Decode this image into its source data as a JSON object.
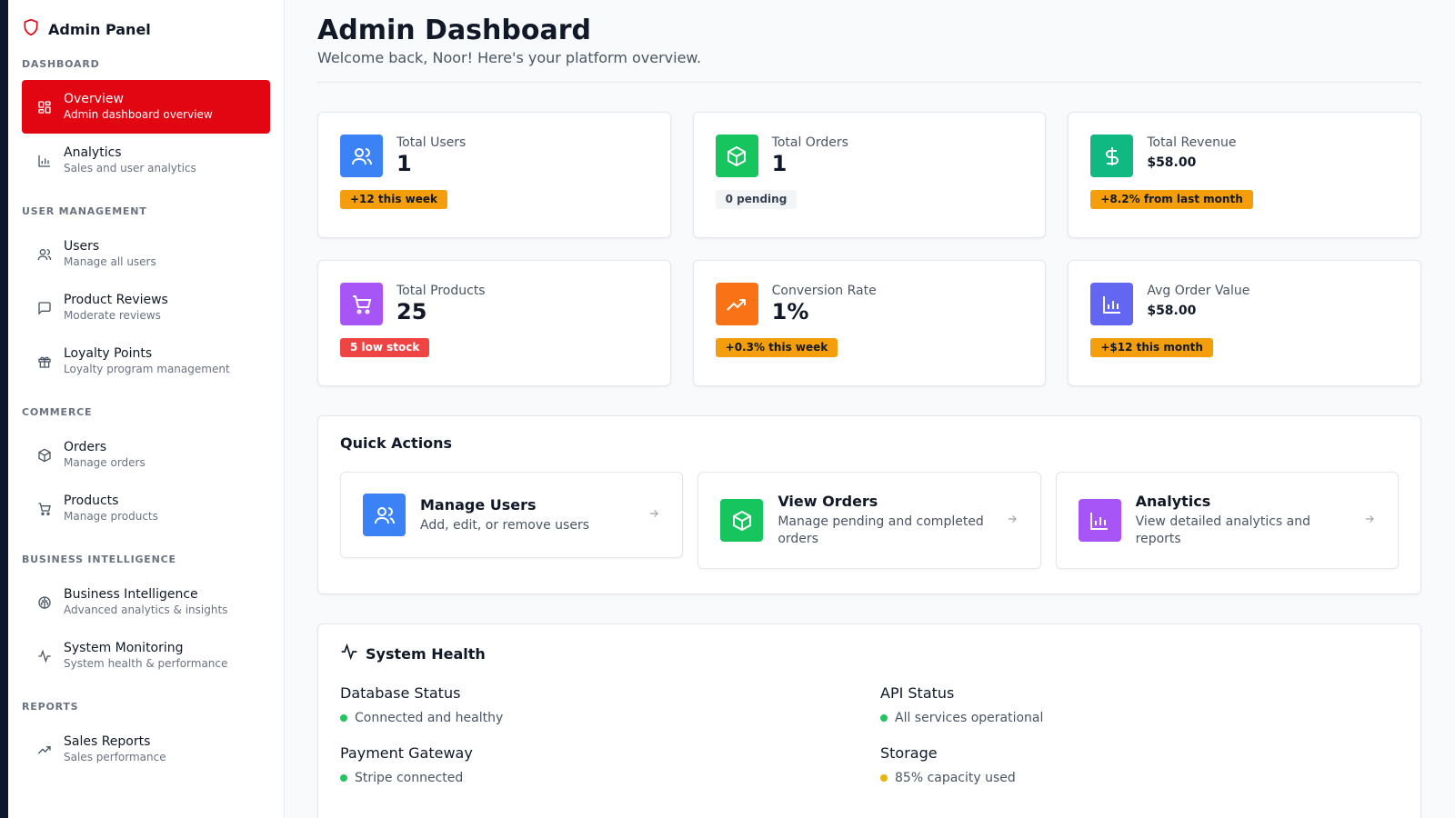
{
  "colors": {
    "accent": "#e20613",
    "blue": "#3b82f6",
    "green": "#16c55e",
    "purple": "#a855f7",
    "orange": "#f97316",
    "indigo": "#6366f1",
    "status_ok": "#22c55e",
    "status_warn": "#eab308"
  },
  "brand": {
    "name": "Admin Panel",
    "icon": "shield-icon"
  },
  "sidebar": {
    "sections": [
      {
        "title": "DASHBOARD",
        "items": [
          {
            "label": "Overview",
            "sub": "Admin dashboard overview",
            "icon": "grid-icon",
            "active": true
          },
          {
            "label": "Analytics",
            "sub": "Sales and user analytics",
            "icon": "bar-chart-icon"
          }
        ]
      },
      {
        "title": "USER MANAGEMENT",
        "items": [
          {
            "label": "Users",
            "sub": "Manage all users",
            "icon": "users-icon"
          },
          {
            "label": "Product Reviews",
            "sub": "Moderate reviews",
            "icon": "message-icon"
          },
          {
            "label": "Loyalty Points",
            "sub": "Loyalty program management",
            "icon": "gift-icon"
          }
        ]
      },
      {
        "title": "COMMERCE",
        "items": [
          {
            "label": "Orders",
            "sub": "Manage orders",
            "icon": "package-icon"
          },
          {
            "label": "Products",
            "sub": "Manage products",
            "icon": "cart-icon"
          }
        ]
      },
      {
        "title": "BUSINESS INTELLIGENCE",
        "items": [
          {
            "label": "Business Intelligence",
            "sub": "Advanced analytics & insights",
            "icon": "brain-icon"
          },
          {
            "label": "System Monitoring",
            "sub": "System health & performance",
            "icon": "activity-icon"
          }
        ]
      },
      {
        "title": "REPORTS",
        "items": [
          {
            "label": "Sales Reports",
            "sub": "Sales performance",
            "icon": "trending-up-icon"
          }
        ]
      }
    ]
  },
  "header": {
    "title": "Admin Dashboard",
    "subtitle": "Welcome back, Noor! Here's your platform overview."
  },
  "stats": [
    {
      "label": "Total Users",
      "value": "1",
      "badge": "+12 this week",
      "badge_style": "orange",
      "icon": "users-icon",
      "color": "#3b82f6",
      "small": false
    },
    {
      "label": "Total Orders",
      "value": "1",
      "badge": "0 pending",
      "badge_style": "gray",
      "icon": "package-icon",
      "color": "#16c55e",
      "small": false
    },
    {
      "label": "Total Revenue",
      "value": "$58.00",
      "badge": "+8.2% from last month",
      "badge_style": "orange",
      "icon": "dollar-icon",
      "color": "#10b981",
      "small": true
    },
    {
      "label": "Total Products",
      "value": "25",
      "badge": "5 low stock",
      "badge_style": "red",
      "icon": "cart-icon",
      "color": "#a855f7",
      "small": false
    },
    {
      "label": "Conversion Rate",
      "value": "1%",
      "badge": "+0.3% this week",
      "badge_style": "orange",
      "icon": "trending-up-icon",
      "color": "#f97316",
      "small": false
    },
    {
      "label": "Avg Order Value",
      "value": "$58.00",
      "badge": "+$12 this month",
      "badge_style": "orange",
      "icon": "bar-chart-icon",
      "color": "#6366f1",
      "small": true
    }
  ],
  "quick_actions": {
    "title": "Quick Actions",
    "items": [
      {
        "label": "Manage Users",
        "desc": "Add, edit, or remove users",
        "icon": "users-icon",
        "color": "#3b82f6"
      },
      {
        "label": "View Orders",
        "desc": "Manage pending and completed orders",
        "icon": "package-icon",
        "color": "#16c55e"
      },
      {
        "label": "Analytics",
        "desc": "View detailed analytics and reports",
        "icon": "bar-chart-icon",
        "color": "#a855f7"
      }
    ]
  },
  "system_health": {
    "title": "System Health",
    "items": [
      {
        "label": "Database Status",
        "status": "Connected and healthy",
        "level": "ok"
      },
      {
        "label": "API Status",
        "status": "All services operational",
        "level": "ok"
      },
      {
        "label": "Payment Gateway",
        "status": "Stripe connected",
        "level": "ok"
      },
      {
        "label": "Storage",
        "status": "85% capacity used",
        "level": "warn"
      }
    ]
  }
}
